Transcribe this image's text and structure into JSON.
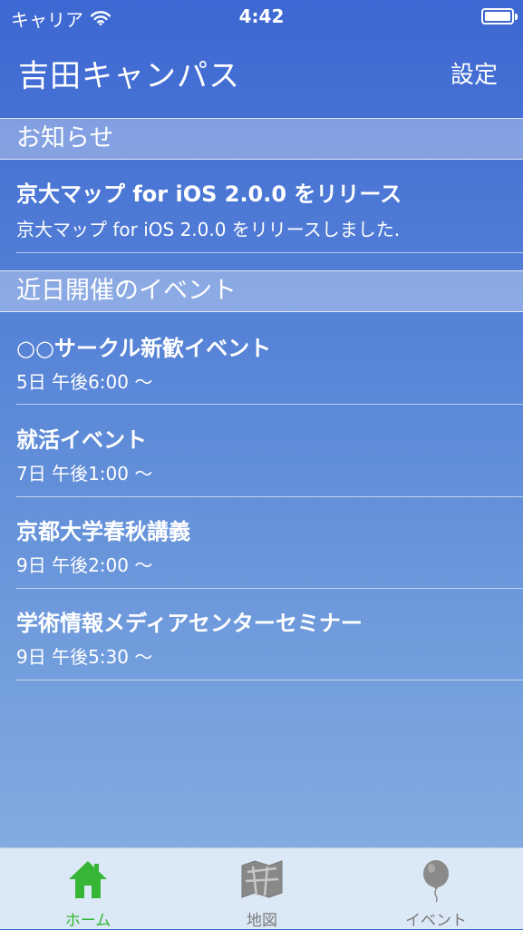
{
  "status_bar": {
    "carrier": "キャリア",
    "time": "4:42",
    "battery_level": 1.0
  },
  "nav": {
    "title": "吉田キャンパス",
    "settings_label": "設定"
  },
  "news": {
    "header": "お知らせ",
    "items": [
      {
        "title": "京大マップ for iOS 2.0.0 をリリース",
        "subtitle": "京大マップ for iOS 2.0.0 をリリースしました."
      }
    ]
  },
  "events": {
    "header": "近日開催のイベント",
    "items": [
      {
        "title": "○○サークル新歓イベント",
        "time": "5日 午後6:00 〜"
      },
      {
        "title": "就活イベント",
        "time": "7日 午後1:00 〜"
      },
      {
        "title": "京都大学春秋講義",
        "time": "9日 午後2:00 〜"
      },
      {
        "title": "学術情報メディアセンターセミナー",
        "time": "9日 午後5:30 〜"
      }
    ]
  },
  "tabs": [
    {
      "label": "ホーム",
      "icon": "home-icon",
      "active": true
    },
    {
      "label": "地図",
      "icon": "map-icon",
      "active": false
    },
    {
      "label": "イベント",
      "icon": "balloon-icon",
      "active": false
    }
  ],
  "colors": {
    "background_top": "#3d67d2",
    "background_bottom": "#89b2e2",
    "tab_active": "#31b531",
    "tab_inactive": "#7a7a7a",
    "tab_bar": "#dbe9f6"
  }
}
